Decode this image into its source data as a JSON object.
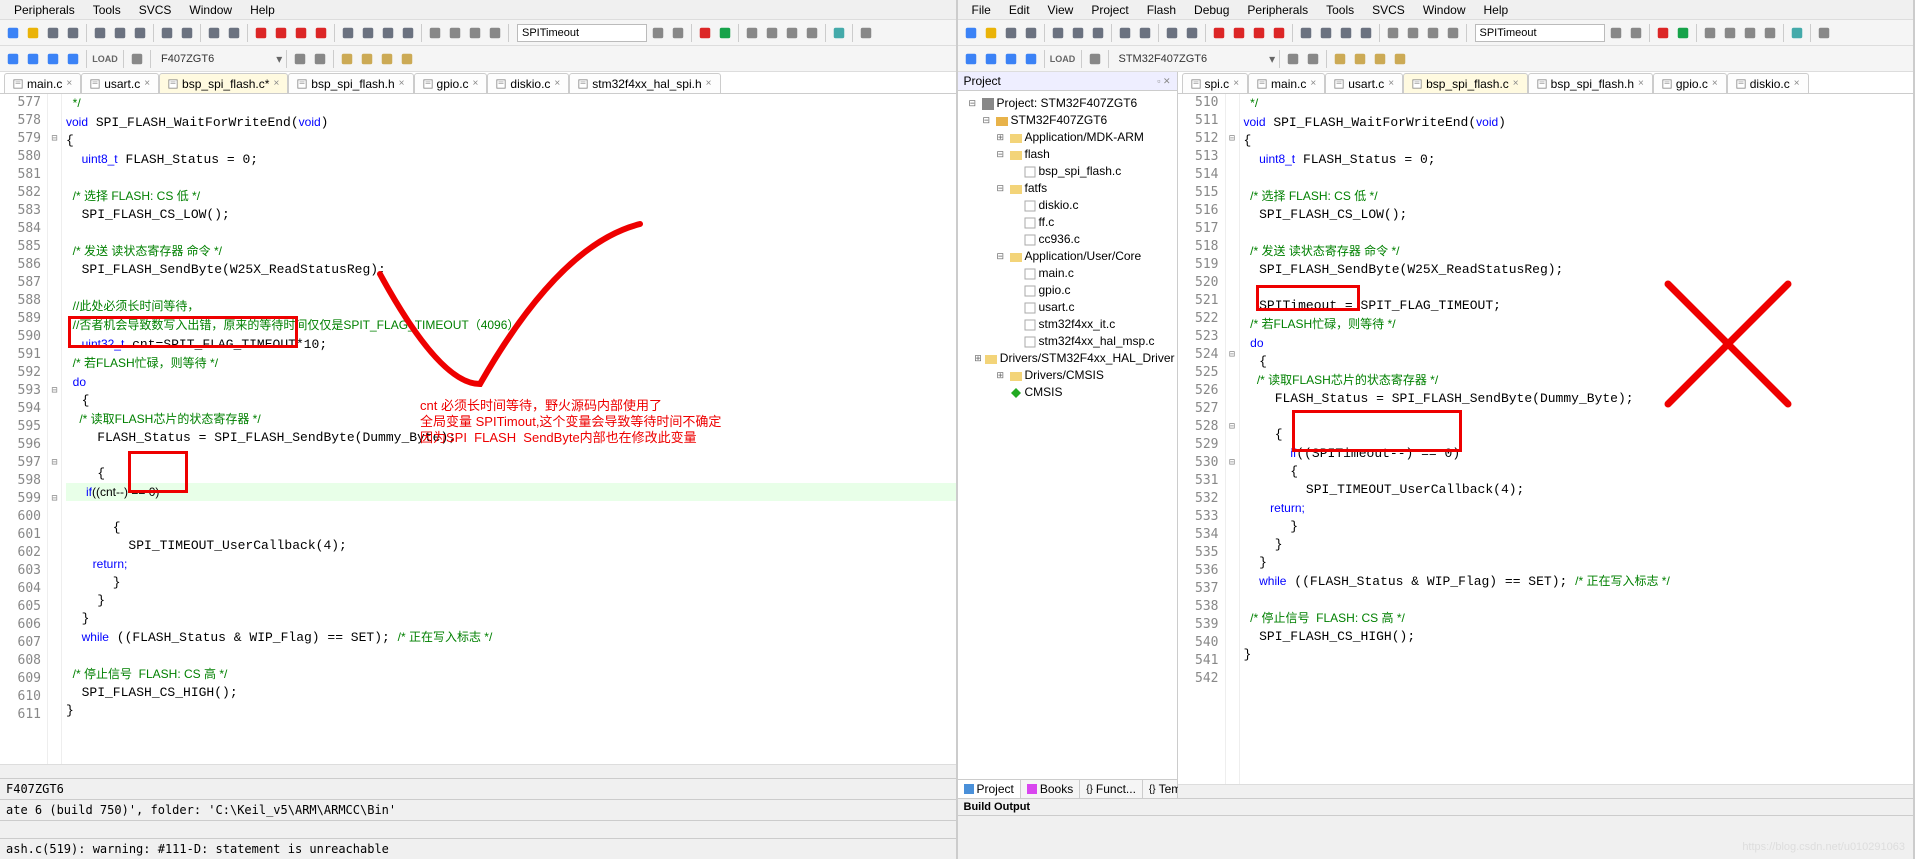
{
  "left": {
    "menubar": [
      "Peripherals",
      "Tools",
      "SVCS",
      "Window",
      "Help"
    ],
    "search": "SPITimeout",
    "target": "F407ZGT6",
    "tabs": [
      {
        "label": "main.c",
        "active": false
      },
      {
        "label": "usart.c",
        "active": false
      },
      {
        "label": "bsp_spi_flash.c*",
        "active": true
      },
      {
        "label": "bsp_spi_flash.h",
        "active": false
      },
      {
        "label": "gpio.c",
        "active": false
      },
      {
        "label": "diskio.c",
        "active": false
      },
      {
        "label": "stm32f4xx_hal_spi.h",
        "active": false
      }
    ],
    "code_start": 577,
    "code": [
      {
        "n": 577,
        "f": "",
        "t": "  */",
        "cls": "cm"
      },
      {
        "n": 578,
        "f": "",
        "t": "void SPI_FLASH_WaitForWriteEnd(void)",
        "parse": "sig"
      },
      {
        "n": 579,
        "f": "⊟",
        "t": "{"
      },
      {
        "n": 580,
        "f": "",
        "t": "  uint8_t FLASH_Status = 0;",
        "parse": "decl8"
      },
      {
        "n": 581,
        "f": "",
        "t": ""
      },
      {
        "n": 582,
        "f": "",
        "t": "  /* 选择 FLASH: CS 低 */",
        "cls": "cm"
      },
      {
        "n": 583,
        "f": "",
        "t": "  SPI_FLASH_CS_LOW();"
      },
      {
        "n": 584,
        "f": "",
        "t": ""
      },
      {
        "n": 585,
        "f": "",
        "t": "  /* 发送 读状态寄存器 命令 */",
        "cls": "cm"
      },
      {
        "n": 586,
        "f": "",
        "t": "  SPI_FLASH_SendByte(W25X_ReadStatusReg);"
      },
      {
        "n": 587,
        "f": "",
        "t": ""
      },
      {
        "n": 588,
        "f": "",
        "t": "  //此处必须长时间等待，",
        "cls": "cm"
      },
      {
        "n": 589,
        "f": "",
        "t": "  //否者机会导致数写入出错，原来的等待时间仅仅是SPIT_FLAG_TIMEOUT（4096）",
        "cls": "cm"
      },
      {
        "n": 590,
        "f": "",
        "t": "  uint32_t cnt=SPIT_FLAG_TIMEOUT*10;",
        "parse": "decl32"
      },
      {
        "n": 591,
        "f": "",
        "t": "  /* 若FLASH忙碌，则等待 */",
        "cls": "cm"
      },
      {
        "n": 592,
        "f": "",
        "t": "  do",
        "cls": "kw"
      },
      {
        "n": 593,
        "f": "⊟",
        "t": "  {"
      },
      {
        "n": 594,
        "f": "",
        "t": "    /* 读取FLASH芯片的状态寄存器 */",
        "cls": "cm"
      },
      {
        "n": 595,
        "f": "",
        "t": "    FLASH_Status = SPI_FLASH_SendByte(Dummy_Byte);"
      },
      {
        "n": 596,
        "f": "",
        "t": ""
      },
      {
        "n": 597,
        "f": "⊟",
        "t": "    {"
      },
      {
        "n": 598,
        "f": "",
        "t": "      if((cnt--) == 0)",
        "parse": "if",
        "hl": true
      },
      {
        "n": 599,
        "f": "⊟",
        "t": "      {"
      },
      {
        "n": 600,
        "f": "",
        "t": "        SPI_TIMEOUT_UserCallback(4);"
      },
      {
        "n": 601,
        "f": "",
        "t": "        return;",
        "cls": "kw"
      },
      {
        "n": 602,
        "f": "",
        "t": "      }"
      },
      {
        "n": 603,
        "f": "",
        "t": "    }"
      },
      {
        "n": 604,
        "f": "",
        "t": "  }"
      },
      {
        "n": 605,
        "f": "",
        "t": "  while ((FLASH_Status & WIP_Flag) == SET); /* 正在写入标志 */",
        "parse": "while"
      },
      {
        "n": 606,
        "f": "",
        "t": ""
      },
      {
        "n": 607,
        "f": "",
        "t": "  /* 停止信号  FLASH: CS 高 */",
        "cls": "cm"
      },
      {
        "n": 608,
        "f": "",
        "t": "  SPI_FLASH_CS_HIGH();"
      },
      {
        "n": 609,
        "f": "",
        "t": "}"
      },
      {
        "n": 610,
        "f": "",
        "t": ""
      },
      {
        "n": 611,
        "f": "",
        "t": ""
      }
    ],
    "annot": "cnt 必须长时间等待，野火源码内部使用了\n全局变量 SPITimout,这个变量会导致等待时间不确定\n因为SPI  FLASH  SendByte内部也在修改此变量",
    "status1": "F407ZGT6",
    "status2": "ate 6 (build 750)', folder: 'C:\\Keil_v5\\ARM\\ARMCC\\Bin'",
    "status3": "ash.c(519): warning:  #111-D: statement is unreachable"
  },
  "right": {
    "menubar": [
      "File",
      "Edit",
      "View",
      "Project",
      "Flash",
      "Debug",
      "Peripherals",
      "Tools",
      "SVCS",
      "Window",
      "Help"
    ],
    "search": "SPITimeout",
    "target": "STM32F407ZGT6",
    "proj_title": "Project",
    "proj_root": "Project: STM32F407ZGT6",
    "tree": [
      {
        "ind": 0,
        "icon": "proj",
        "label": "Project: STM32F407ZGT6",
        "exp": "-"
      },
      {
        "ind": 1,
        "icon": "tgt",
        "label": "STM32F407ZGT6",
        "exp": "-"
      },
      {
        "ind": 2,
        "icon": "grp",
        "label": "Application/MDK-ARM",
        "exp": "+"
      },
      {
        "ind": 2,
        "icon": "grp",
        "label": "flash",
        "exp": "-"
      },
      {
        "ind": 3,
        "icon": "c",
        "label": "bsp_spi_flash.c"
      },
      {
        "ind": 2,
        "icon": "grp",
        "label": "fatfs",
        "exp": "-"
      },
      {
        "ind": 3,
        "icon": "c",
        "label": "diskio.c"
      },
      {
        "ind": 3,
        "icon": "c",
        "label": "ff.c"
      },
      {
        "ind": 3,
        "icon": "c",
        "label": "cc936.c"
      },
      {
        "ind": 2,
        "icon": "grp",
        "label": "Application/User/Core",
        "exp": "-"
      },
      {
        "ind": 3,
        "icon": "c",
        "label": "main.c"
      },
      {
        "ind": 3,
        "icon": "c",
        "label": "gpio.c"
      },
      {
        "ind": 3,
        "icon": "c",
        "label": "usart.c"
      },
      {
        "ind": 3,
        "icon": "c",
        "label": "stm32f4xx_it.c"
      },
      {
        "ind": 3,
        "icon": "c",
        "label": "stm32f4xx_hal_msp.c"
      },
      {
        "ind": 2,
        "icon": "grp",
        "label": "Drivers/STM32F4xx_HAL_Driver",
        "exp": "+"
      },
      {
        "ind": 2,
        "icon": "grp",
        "label": "Drivers/CMSIS",
        "exp": "+"
      },
      {
        "ind": 2,
        "icon": "cmsis",
        "label": "CMSIS"
      }
    ],
    "proj_tabs": [
      "Project",
      "Books",
      "Funct...",
      "Templ..."
    ],
    "tabs": [
      {
        "label": "spi.c",
        "active": false
      },
      {
        "label": "main.c",
        "active": false
      },
      {
        "label": "usart.c",
        "active": false
      },
      {
        "label": "bsp_spi_flash.c",
        "active": true
      },
      {
        "label": "bsp_spi_flash.h",
        "active": false
      },
      {
        "label": "gpio.c",
        "active": false
      },
      {
        "label": "diskio.c",
        "active": false
      }
    ],
    "code": [
      {
        "n": 510,
        "f": "",
        "t": "  */",
        "cls": "cm"
      },
      {
        "n": 511,
        "f": "",
        "t": "void SPI_FLASH_WaitForWriteEnd(void)",
        "parse": "sig"
      },
      {
        "n": 512,
        "f": "⊟",
        "t": "{"
      },
      {
        "n": 513,
        "f": "",
        "t": "  uint8_t FLASH_Status = 0;",
        "parse": "decl8"
      },
      {
        "n": 514,
        "f": "",
        "t": ""
      },
      {
        "n": 515,
        "f": "",
        "t": "  /* 选择 FLASH: CS 低 */",
        "cls": "cm"
      },
      {
        "n": 516,
        "f": "",
        "t": "  SPI_FLASH_CS_LOW();"
      },
      {
        "n": 517,
        "f": "",
        "t": ""
      },
      {
        "n": 518,
        "f": "",
        "t": "  /* 发送 读状态寄存器 命令 */",
        "cls": "cm"
      },
      {
        "n": 519,
        "f": "",
        "t": "  SPI_FLASH_SendByte(W25X_ReadStatusReg);"
      },
      {
        "n": 520,
        "f": "",
        "t": ""
      },
      {
        "n": 521,
        "f": "",
        "t": "  SPITimeout = SPIT_FLAG_TIMEOUT;"
      },
      {
        "n": 522,
        "f": "",
        "t": "  /* 若FLASH忙碌，则等待 */",
        "cls": "cm"
      },
      {
        "n": 523,
        "f": "",
        "t": "  do",
        "cls": "kw"
      },
      {
        "n": 524,
        "f": "⊟",
        "t": "  {"
      },
      {
        "n": 525,
        "f": "",
        "t": "    /* 读取FLASH芯片的状态寄存器 */",
        "cls": "cm"
      },
      {
        "n": 526,
        "f": "",
        "t": "    FLASH_Status = SPI_FLASH_SendByte(Dummy_Byte);"
      },
      {
        "n": 527,
        "f": "",
        "t": ""
      },
      {
        "n": 528,
        "f": "⊟",
        "t": "    {"
      },
      {
        "n": 529,
        "f": "",
        "t": "      if((SPITimeout--) == 0)",
        "parse": "if"
      },
      {
        "n": 530,
        "f": "⊟",
        "t": "      {"
      },
      {
        "n": 531,
        "f": "",
        "t": "        SPI_TIMEOUT_UserCallback(4);"
      },
      {
        "n": 532,
        "f": "",
        "t": "        return;",
        "cls": "kw"
      },
      {
        "n": 533,
        "f": "",
        "t": "      }"
      },
      {
        "n": 534,
        "f": "",
        "t": "    }"
      },
      {
        "n": 535,
        "f": "",
        "t": "  }"
      },
      {
        "n": 536,
        "f": "",
        "t": "  while ((FLASH_Status & WIP_Flag) == SET); /* 正在写入标志 */",
        "parse": "while"
      },
      {
        "n": 537,
        "f": "",
        "t": ""
      },
      {
        "n": 538,
        "f": "",
        "t": "  /* 停止信号  FLASH: CS 高 */",
        "cls": "cm"
      },
      {
        "n": 539,
        "f": "",
        "t": "  SPI_FLASH_CS_HIGH();"
      },
      {
        "n": 540,
        "f": "",
        "t": "}"
      },
      {
        "n": 541,
        "f": "",
        "t": ""
      },
      {
        "n": 542,
        "f": "",
        "t": ""
      }
    ],
    "build_title": "Build Output"
  },
  "icons": {
    "new": "#3b82f6",
    "open": "#eab308",
    "save": "#6b7280",
    "saveall": "#6b7280",
    "cut": "#6b7280",
    "copy": "#6b7280",
    "paste": "#6b7280",
    "undo": "#6b7280",
    "redo": "#6b7280",
    "back": "#6b7280",
    "fwd": "#6b7280",
    "flag": "#dc2626",
    "bm": "#3b82f6",
    "indent": "#6b7280",
    "outdent": "#6b7280",
    "find": "#6b7280",
    "debug": "#dc2626",
    "stop": "#dc2626",
    "run": "#16a34a",
    "build": "#3b82f6",
    "rebuild": "#3b82f6",
    "load": "#6b7280",
    "cfg": "#6b7280"
  }
}
